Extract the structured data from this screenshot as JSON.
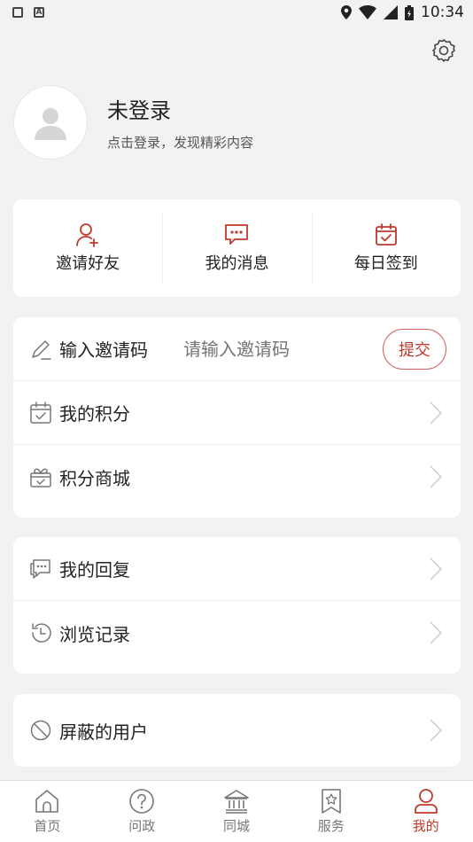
{
  "status_bar": {
    "time": "10:34",
    "left_icons": [
      "mail-icon",
      "a-icon"
    ],
    "right_icons": [
      "location-icon",
      "wifi-icon",
      "signal-icon",
      "battery-icon"
    ]
  },
  "profile": {
    "name": "未登录",
    "subtitle": "点击登录，发现精彩内容",
    "avatar_icon": "user-avatar-icon"
  },
  "quick_actions": [
    {
      "label": "邀请好友",
      "icon": "add-user-icon"
    },
    {
      "label": "我的消息",
      "icon": "message-icon"
    },
    {
      "label": "每日签到",
      "icon": "calendar-check-icon"
    }
  ],
  "invite": {
    "label": "输入邀请码",
    "placeholder": "请输入邀请码",
    "submit_label": "提交",
    "icon": "pencil-icon"
  },
  "group1": [
    {
      "label": "我的积分",
      "icon": "calendar-check-icon"
    },
    {
      "label": "积分商城",
      "icon": "gift-icon"
    }
  ],
  "group2": [
    {
      "label": "我的回复",
      "icon": "comment-icon"
    },
    {
      "label": "浏览记录",
      "icon": "history-icon"
    }
  ],
  "group3": [
    {
      "label": "屏蔽的用户",
      "icon": "block-icon"
    }
  ],
  "bottom_nav": [
    {
      "label": "首页",
      "icon": "home-icon",
      "active": false
    },
    {
      "label": "问政",
      "icon": "question-icon",
      "active": false
    },
    {
      "label": "同城",
      "icon": "bank-icon",
      "active": false
    },
    {
      "label": "服务",
      "icon": "star-bookmark-icon",
      "active": false
    },
    {
      "label": "我的",
      "icon": "user-icon",
      "active": true
    }
  ],
  "colors": {
    "accent": "#c0392b",
    "background": "#f2f2f2",
    "card": "#ffffff"
  }
}
